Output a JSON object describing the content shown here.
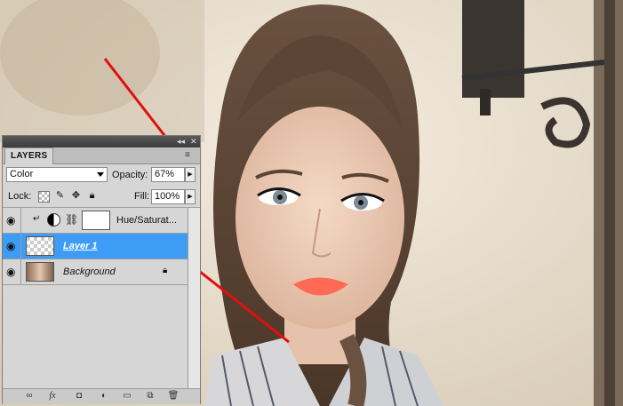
{
  "panel": {
    "tab": "LAYERS",
    "collapse_glyph": "◂◂",
    "close_glyph": "✕",
    "menu_glyph": "≡"
  },
  "blend": {
    "mode": "Color",
    "opacity_label": "Opacity:",
    "opacity": "67%"
  },
  "lock": {
    "label": "Lock:",
    "fill_label": "Fill:",
    "fill": "100%"
  },
  "layers": [
    {
      "name": "Hue/Saturat...",
      "type": "adjustment",
      "visible": true,
      "clipped": true
    },
    {
      "name": "Layer 1",
      "type": "pixel",
      "visible": true,
      "selected": true
    },
    {
      "name": "Background",
      "type": "background",
      "visible": true,
      "locked": true
    }
  ],
  "bottom_icons": [
    "link-icon",
    "fx-icon",
    "mask-icon",
    "adjustment-icon",
    "group-icon",
    "new-layer-icon",
    "trash-icon"
  ],
  "bottom_labels": {
    "fx": "fx"
  },
  "colors": {
    "selected_row": "#3d9cf4",
    "arrow": "#e01010",
    "lips": "#ff6a55"
  }
}
